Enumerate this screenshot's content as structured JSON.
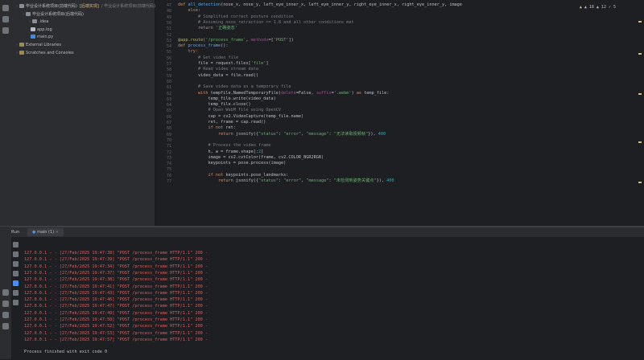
{
  "sidebar": {
    "rows": [
      {
        "indent": 0,
        "icon": "folder",
        "text": "毕业设计系统项目(前端代码)",
        "suffix": "[后端实现]",
        "note": "/ 毕业设计系统项目(前端代码)"
      },
      {
        "indent": 1,
        "icon": "folder",
        "text": "毕业设计系统项目(后端代码)",
        "suffix": "",
        "note": ""
      },
      {
        "indent": 2,
        "icon": "folder",
        "text": ".idea",
        "suffix": "",
        "note": ""
      },
      {
        "indent": 2,
        "icon": "file-log",
        "text": "app.log",
        "suffix": "",
        "note": ""
      },
      {
        "indent": 2,
        "icon": "file-py",
        "text": "main.py",
        "suffix": "",
        "note": ""
      },
      {
        "indent": 0,
        "icon": "lib",
        "text": "External Libraries",
        "suffix": "",
        "note": ""
      },
      {
        "indent": 0,
        "icon": "lib",
        "text": "Scratches and Consoles",
        "suffix": "",
        "note": ""
      }
    ]
  },
  "editor": {
    "status": "▲ 18  ▲ 12  ✓ 5",
    "line_numbers": [
      "47",
      "48",
      "49",
      "50",
      "51",
      "52",
      "53",
      "54",
      "55",
      "56",
      "57",
      "58",
      "59",
      "60",
      "61",
      "62",
      "63",
      "64",
      "65",
      "66",
      "67",
      "68",
      "69",
      "70",
      "71",
      "72",
      "73",
      "74",
      "75",
      "76",
      "77",
      "78",
      "79",
      "80",
      "81",
      "82",
      "83",
      "84",
      "85"
    ],
    "lines": [
      [
        {
          "c": "kw",
          "t": "def "
        },
        {
          "c": "fn",
          "t": "all_detection"
        },
        {
          "c": "ident",
          "t": "(nose_x, nose_y, left_eye_inner_x, left_eye_inner_y, right_eye_inner_x, right_eye_inner_y, image"
        }
      ],
      [
        {
          "c": "kw",
          "t": "    else:"
        }
      ],
      [
        {
          "c": "cmt",
          "t": "        # Simplified correct posture condition"
        }
      ],
      [
        {
          "c": "cmt",
          "t": "        # Assuming nose_retraction >= 1.8 and all other conditions met"
        }
      ],
      [
        {
          "c": "kw",
          "t": "        return "
        },
        {
          "c": "str",
          "t": "'正确姿态'"
        }
      ],
      [
        {
          "c": "ident",
          "t": ""
        }
      ],
      [
        {
          "c": "dec",
          "t": "@app.route("
        },
        {
          "c": "str",
          "t": "'/process_frame'"
        },
        {
          "c": "ident",
          "t": ", "
        },
        {
          "c": "self",
          "t": "methods"
        },
        {
          "c": "ident",
          "t": "=["
        },
        {
          "c": "str",
          "t": "'POST'"
        },
        {
          "c": "ident",
          "t": "])"
        }
      ],
      [
        {
          "c": "kw",
          "t": "def "
        },
        {
          "c": "fn",
          "t": "process_frame"
        },
        {
          "c": "ident",
          "t": "():"
        }
      ],
      [
        {
          "c": "kw",
          "t": "    try:"
        }
      ],
      [
        {
          "c": "cmt",
          "t": "        # Get video file"
        }
      ],
      [
        {
          "c": "ident",
          "t": "        file = request.files["
        },
        {
          "c": "str",
          "t": "'file'"
        },
        {
          "c": "ident",
          "t": "]"
        }
      ],
      [
        {
          "c": "cmt",
          "t": "        # Read video stream data"
        }
      ],
      [
        {
          "c": "ident",
          "t": "        video_data = file.read()"
        }
      ],
      [
        {
          "c": "ident",
          "t": ""
        }
      ],
      [
        {
          "c": "cmt",
          "t": "        # Save video data as a temporary file"
        }
      ],
      [
        {
          "c": "kw",
          "t": "        with "
        },
        {
          "c": "ident",
          "t": "tempfile.NamedTemporaryFile("
        },
        {
          "c": "self",
          "t": "delete"
        },
        {
          "c": "ident",
          "t": "=False, "
        },
        {
          "c": "self",
          "t": "suffix"
        },
        {
          "c": "ident",
          "t": "="
        },
        {
          "c": "str",
          "t": "'.webm'"
        },
        {
          "c": "ident",
          "t": ") "
        },
        {
          "c": "kw",
          "t": "as "
        },
        {
          "c": "ident",
          "t": "temp_file:"
        }
      ],
      [
        {
          "c": "ident",
          "t": "            temp_file.write(video_data)"
        }
      ],
      [
        {
          "c": "ident",
          "t": "            temp_file.close()"
        }
      ],
      [
        {
          "c": "cmt",
          "t": "            # Open WebM file using OpenCV"
        }
      ],
      [
        {
          "c": "ident",
          "t": "            cap = cv2.VideoCapture(temp_file.name)"
        }
      ],
      [
        {
          "c": "ident",
          "t": "            ret, frame = cap.read()"
        }
      ],
      [
        {
          "c": "kw",
          "t": "            if not "
        },
        {
          "c": "ident",
          "t": "ret:"
        }
      ],
      [
        {
          "c": "kw",
          "t": "                return "
        },
        {
          "c": "ident",
          "t": "jsonify({"
        },
        {
          "c": "str",
          "t": "\"status\""
        },
        {
          "c": "ident",
          "t": ": "
        },
        {
          "c": "str",
          "t": "\"error\""
        },
        {
          "c": "ident",
          "t": ", "
        },
        {
          "c": "str",
          "t": "\"message\""
        },
        {
          "c": "ident",
          "t": ": "
        },
        {
          "c": "str",
          "t": "\"无法读取视频帧\""
        },
        {
          "c": "ident",
          "t": "}), "
        },
        {
          "c": "num",
          "t": "400"
        }
      ],
      [
        {
          "c": "ident",
          "t": ""
        }
      ],
      [
        {
          "c": "cmt",
          "t": "            # Process the video frame"
        }
      ],
      [
        {
          "c": "ident",
          "t": "            h, w = frame.shape[:"
        },
        {
          "c": "num",
          "t": "2"
        },
        {
          "c": "ident",
          "t": "]"
        }
      ],
      [
        {
          "c": "ident",
          "t": "            image = cv2.cvtColor(frame, cv2.COLOR_BGR2RGB)"
        }
      ],
      [
        {
          "c": "ident",
          "t": "            keypoints = pose.process(image)"
        }
      ],
      [
        {
          "c": "ident",
          "t": ""
        }
      ],
      [
        {
          "c": "kw",
          "t": "            if not "
        },
        {
          "c": "ident",
          "t": "keypoints.pose_landmarks:"
        }
      ],
      [
        {
          "c": "kw",
          "t": "                return "
        },
        {
          "c": "ident",
          "t": "jsonify({"
        },
        {
          "c": "str",
          "t": "\"status\""
        },
        {
          "c": "ident",
          "t": ": "
        },
        {
          "c": "str",
          "t": "\"error\""
        },
        {
          "c": "ident",
          "t": ", "
        },
        {
          "c": "str",
          "t": "\"message\""
        },
        {
          "c": "ident",
          "t": ": "
        },
        {
          "c": "str",
          "t": "\"未检测到姿势关键点\""
        },
        {
          "c": "ident",
          "t": "}), "
        },
        {
          "c": "num",
          "t": "400"
        }
      ]
    ]
  },
  "run": {
    "label": "Run",
    "tab": "main (1)",
    "logs": [
      "127.0.0.1 - - [27/Feb/2025 19:47:38] \"POST /process_frame HTTP/1.1\" 200 -",
      "127.0.0.1 - - [27/Feb/2025 19:47:39] \"POST /process_frame HTTP/1.1\" 200 -",
      "127.0.0.1 - - [27/Feb/2025 19:47:34] \"POST /process_frame HTTP/1.1\" 200 -",
      "127.0.0.1 - - [27/Feb/2025 19:47:37] \"POST /process_frame HTTP/1.1\" 200 -",
      "127.0.0.1 - - [27/Feb/2025 19:47:38] \"POST /process_frame HTTP/1.1\" 200 -",
      "127.0.0.1 - - [27/Feb/2025 19:47:41] \"POST /process_frame HTTP/1.1\" 200 -",
      "127.0.0.1 - - [27/Feb/2025 19:47:43] \"POST /process_frame HTTP/1.1\" 200 -",
      "127.0.0.1 - - [27/Feb/2025 19:47:46] \"POST /process_frame HTTP/1.1\" 200 -",
      "127.0.0.1 - - [27/Feb/2025 19:47:47] \"POST /process_frame HTTP/1.1\" 200 -",
      "127.0.0.1 - - [27/Feb/2025 19:47:49] \"POST /process_frame HTTP/1.1\" 200 -",
      "127.0.0.1 - - [27/Feb/2025 19:47:50] \"POST /process_frame HTTP/1.1\" 200 -",
      "127.0.0.1 - - [27/Feb/2025 19:47:52] \"POST /process_frame HTTP/1.1\" 200 -",
      "127.0.0.1 - - [27/Feb/2025 19:47:53] \"POST /process_frame HTTP/1.1\" 200 -",
      "127.0.0.1 - - [27/Feb/2025 19:47:57] \"POST /process_frame HTTP/1.1\" 200 -"
    ],
    "finish": "Process finished with exit code 0"
  }
}
